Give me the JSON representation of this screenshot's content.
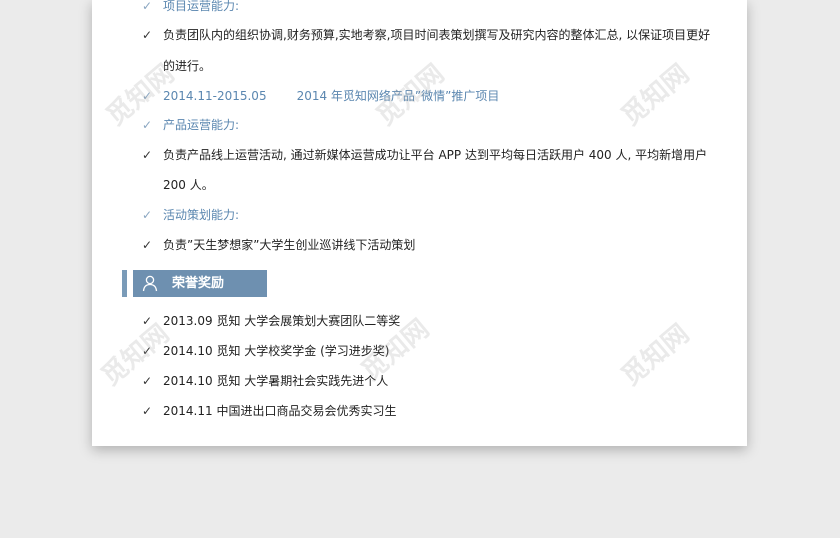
{
  "watermark": "觅知网",
  "check_mark": "✓",
  "experience": {
    "items": [
      {
        "type": "label",
        "text": "项目运营能力:"
      },
      {
        "type": "bullet",
        "text": "负责团队内的组织协调,财务预算,实地考察,项目时间表策划撰写及研究内容的整体汇总, 以保证项目更好"
      },
      {
        "type": "continuation",
        "text": "的进行。"
      },
      {
        "type": "label",
        "date": "2014.11-2015.05",
        "text": "2014 年觅知网络产品”微情”推广项目"
      },
      {
        "type": "label",
        "text": "产品运营能力:"
      },
      {
        "type": "bullet",
        "text": "负责产品线上运营活动, 通过新媒体运营成功让平台 APP 达到平均每日活跃用户 400 人, 平均新增用户"
      },
      {
        "type": "continuation",
        "text": "200 人。"
      },
      {
        "type": "label",
        "text": "活动策划能力:"
      },
      {
        "type": "bullet",
        "text": "负责”天生梦想家”大学生创业巡讲线下活动策划"
      }
    ]
  },
  "honors": {
    "title": "荣誉奖励",
    "items": [
      "2013.09 觅知  大学会展策划大赛团队二等奖",
      "2014.10 觅知  大学校奖学金 (学习进步奖)",
      "2014.10 觅知  大学暑期社会实践先进个人",
      "2014.11 中国进出口商品交易会优秀实习生"
    ]
  }
}
